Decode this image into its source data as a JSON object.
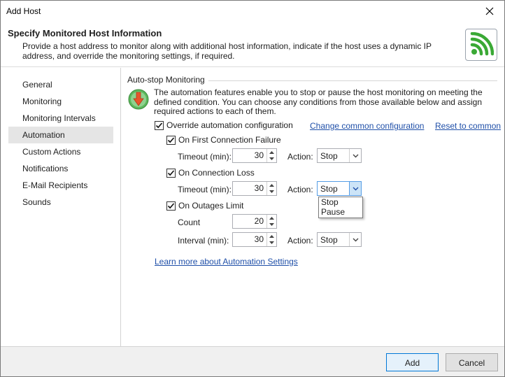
{
  "window": {
    "title": "Add Host"
  },
  "header": {
    "title": "Specify Monitored Host Information",
    "description": "Provide a host address to monitor along with additional host information, indicate if the host uses a dynamic IP address, and override the monitoring settings, if required."
  },
  "sidebar": {
    "items": [
      {
        "label": "General"
      },
      {
        "label": "Monitoring"
      },
      {
        "label": "Monitoring Intervals"
      },
      {
        "label": "Automation"
      },
      {
        "label": "Custom Actions"
      },
      {
        "label": "Notifications"
      },
      {
        "label": "E-Mail Recipients"
      },
      {
        "label": "Sounds"
      }
    ],
    "active": "Automation"
  },
  "main": {
    "group_title": "Auto-stop Monitoring",
    "intro": "The automation features enable you to stop or pause the host monitoring on meeting the defined condition. You can choose any conditions from those available below and assign required actions to each of them.",
    "override": {
      "label": "Override automation configuration",
      "checked": true
    },
    "change_link": "Change common configuration",
    "reset_link": "Reset to common",
    "first_failure": {
      "label": "On First Connection Failure",
      "checked": true,
      "timeout_label": "Timeout (min):",
      "timeout_value": "30",
      "action_label": "Action:",
      "action_value": "Stop"
    },
    "connection_loss": {
      "label": "On Connection Loss",
      "checked": true,
      "timeout_label": "Timeout (min):",
      "timeout_value": "30",
      "action_label": "Action:",
      "action_value": "Stop",
      "options": [
        "Stop",
        "Pause"
      ]
    },
    "outages": {
      "label": "On Outages Limit",
      "checked": true,
      "count_label": "Count",
      "count_value": "20",
      "interval_label": "Interval (min):",
      "interval_value": "30",
      "action_label": "Action:",
      "action_value": "Stop"
    },
    "learn_more": "Learn more about Automation Settings"
  },
  "footer": {
    "add_label": "Add",
    "cancel_label": "Cancel"
  },
  "colors": {
    "link": "#1f4fa8",
    "accent": "#0078d7",
    "logo_green": "#3aa935",
    "info_green": "#4caf50",
    "arrow_red": "#e8542c"
  },
  "icons": {
    "close": "close-icon",
    "logo": "wifi-signal-icon",
    "info": "stop-arrow-icon",
    "check": "checkmark-icon",
    "spin_up": "triangle-up-icon",
    "spin_down": "triangle-down-icon",
    "dropdown": "chevron-down-icon"
  }
}
